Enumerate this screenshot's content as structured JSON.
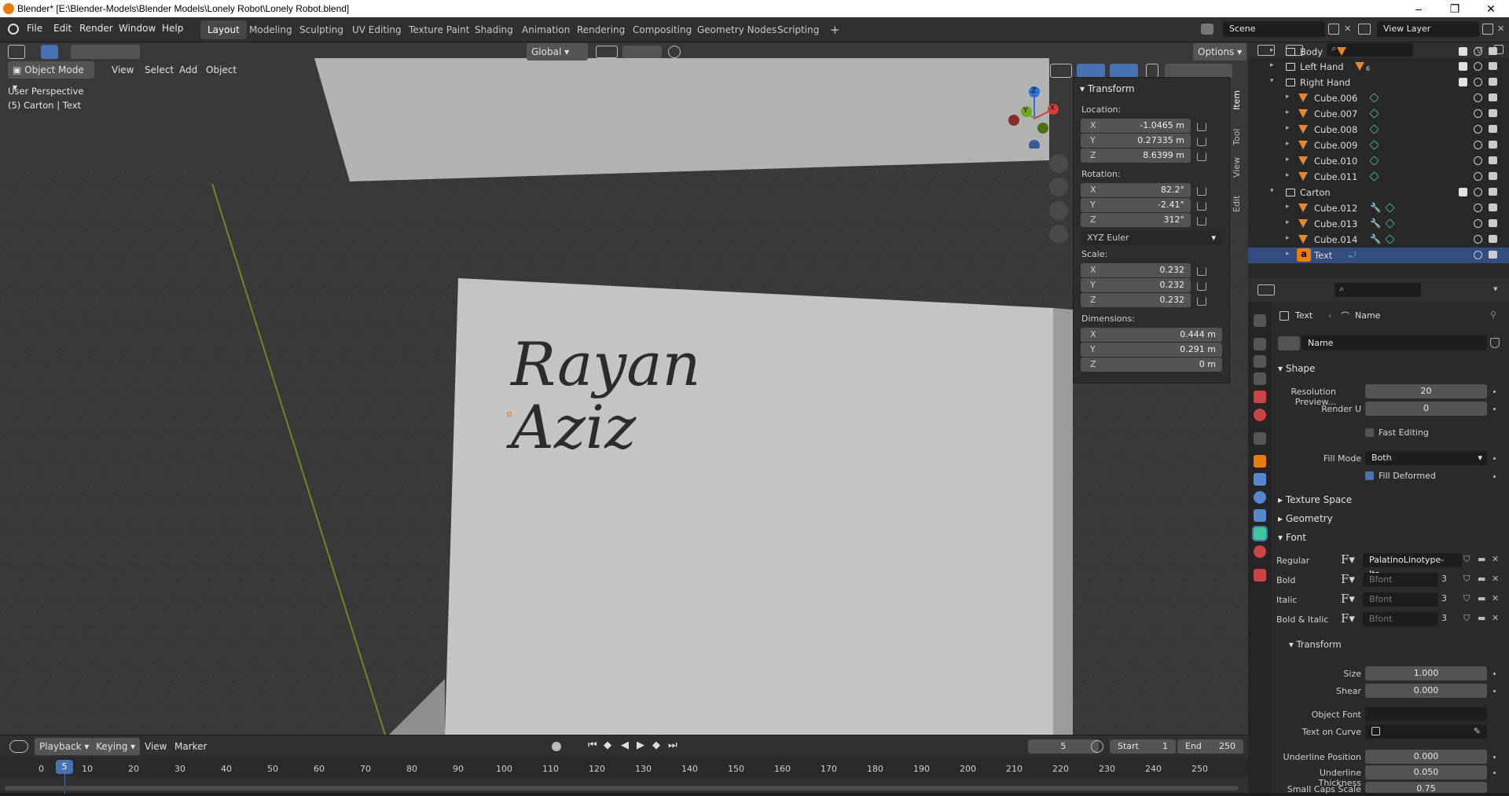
{
  "window": {
    "title": "Blender* [E:\\Blender-Models\\Blender Models\\Lonely Robot\\Lonely Robot.blend]"
  },
  "menu": [
    "File",
    "Edit",
    "Render",
    "Window",
    "Help"
  ],
  "workspaces": [
    "Layout",
    "Modeling",
    "Sculpting",
    "UV Editing",
    "Texture Paint",
    "Shading",
    "Animation",
    "Rendering",
    "Compositing",
    "Geometry Nodes",
    "Scripting"
  ],
  "active_workspace": "Layout",
  "scene": {
    "name": "Scene",
    "view_layer": "View Layer"
  },
  "viewport": {
    "mode": "Object Mode",
    "header_menus": [
      "View",
      "Select",
      "Add",
      "Object"
    ],
    "transform_orientation": "Global",
    "options_label": "Options",
    "overlay_line1": "User Perspective",
    "overlay_line2": "(5) Carton | Text",
    "carton_text_line1": "Rayan",
    "carton_text_line2": "Aziz",
    "gizmo_axes": [
      "Z",
      "Y",
      "X"
    ]
  },
  "npanel": {
    "section": "Transform",
    "location_label": "Location:",
    "location": [
      {
        "axis": "X",
        "value": "-1.0465 m"
      },
      {
        "axis": "Y",
        "value": "0.27335 m"
      },
      {
        "axis": "Z",
        "value": "8.6399 m"
      }
    ],
    "rotation_label": "Rotation:",
    "rotation": [
      {
        "axis": "X",
        "value": "82.2°"
      },
      {
        "axis": "Y",
        "value": "-2.41°"
      },
      {
        "axis": "Z",
        "value": "312°"
      }
    ],
    "rotation_mode": "XYZ Euler",
    "scale_label": "Scale:",
    "scale": [
      {
        "axis": "X",
        "value": "0.232"
      },
      {
        "axis": "Y",
        "value": "0.232"
      },
      {
        "axis": "Z",
        "value": "0.232"
      }
    ],
    "dimensions_label": "Dimensions:",
    "dimensions": [
      {
        "axis": "X",
        "value": "0.444 m"
      },
      {
        "axis": "Y",
        "value": "0.291 m"
      },
      {
        "axis": "Z",
        "value": "0 m"
      }
    ],
    "tabs": [
      "Item",
      "Tool",
      "View",
      "Edit"
    ]
  },
  "outliner": {
    "rows": [
      {
        "name": "Body",
        "type": "mesh"
      },
      {
        "name": "Left Hand",
        "type": "collection",
        "badge": "6"
      },
      {
        "name": "Right Hand",
        "type": "collection"
      },
      {
        "name": "Cube.006",
        "type": "mesh"
      },
      {
        "name": "Cube.007",
        "type": "mesh"
      },
      {
        "name": "Cube.008",
        "type": "mesh"
      },
      {
        "name": "Cube.009",
        "type": "mesh"
      },
      {
        "name": "Cube.010",
        "type": "mesh"
      },
      {
        "name": "Cube.011",
        "type": "mesh"
      },
      {
        "name": "Carton",
        "type": "collection"
      },
      {
        "name": "Cube.012",
        "type": "mesh"
      },
      {
        "name": "Cube.013",
        "type": "mesh"
      },
      {
        "name": "Cube.014",
        "type": "mesh"
      },
      {
        "name": "Text",
        "type": "text"
      }
    ]
  },
  "properties": {
    "breadcrumb_object": "Text",
    "breadcrumb_data": "Name",
    "datablock_name": "Name",
    "shape": {
      "header": "Shape",
      "resolution_preview_label": "Resolution Preview...",
      "resolution_preview": "20",
      "render_u_label": "Render U",
      "render_u": "0",
      "fast_editing_label": "Fast Editing",
      "fill_mode_label": "Fill Mode",
      "fill_mode": "Both",
      "fill_deformed_label": "Fill Deformed"
    },
    "texture_space_header": "Texture Space",
    "geometry_header": "Geometry",
    "font": {
      "header": "Font",
      "regular_label": "Regular",
      "regular": "PalatinoLinotype-Ita...",
      "bold_label": "Bold",
      "bold": "Bfont",
      "italic_label": "Italic",
      "italic": "Bfont",
      "bold_italic_label": "Bold & Italic",
      "bold_italic": "Bfont",
      "user_count": "3"
    },
    "transform": {
      "header": "Transform",
      "size_label": "Size",
      "size": "1.000",
      "shear_label": "Shear",
      "shear": "0.000",
      "object_font_label": "Object Font",
      "text_on_curve_label": "Text on Curve",
      "underline_position_label": "Underline Position",
      "underline_position": "0.000",
      "underline_thickness_label": "Underline Thickness",
      "underline_thickness": "0.050",
      "small_caps_scale_label": "Small Caps Scale",
      "small_caps_scale": "0.75"
    }
  },
  "timeline": {
    "menus": [
      "Playback",
      "Keying",
      "View",
      "Marker"
    ],
    "current_frame": "5",
    "start_label": "Start",
    "start": "1",
    "end_label": "End",
    "end": "250",
    "ticks": [
      "0",
      "5",
      "10",
      "20",
      "30",
      "40",
      "50",
      "60",
      "70",
      "80",
      "90",
      "100",
      "110",
      "120",
      "130",
      "140",
      "150",
      "160",
      "170",
      "180",
      "190",
      "200",
      "210",
      "220",
      "230",
      "240",
      "250"
    ]
  },
  "colors": {
    "accent": "#4772b3",
    "object_orange": "#e87d0d",
    "mesh_green": "#3fc79c"
  }
}
